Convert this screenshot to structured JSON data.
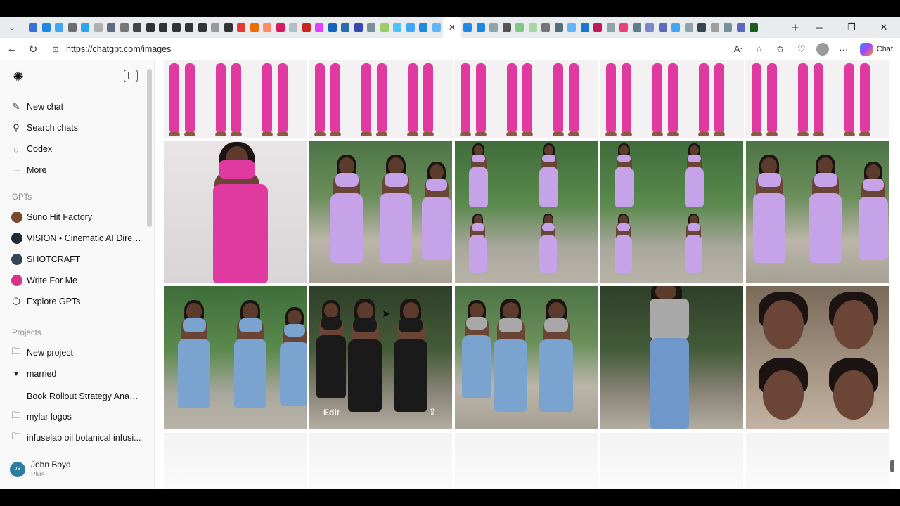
{
  "browser": {
    "url": "https://chatgpt.com/images",
    "copilot_label": "Chat",
    "tab_colors": [
      "#3b6fd8",
      "#1e88e5",
      "#42a5f5",
      "#6d6d6d",
      "#2ea3f2",
      "#b0b0b0",
      "#5d6d7e",
      "#777777",
      "#444444",
      "#333333",
      "#333333",
      "#333333",
      "#333333",
      "#333333",
      "#999999",
      "#333333",
      "#e53935",
      "#ef6c00",
      "#ff8a65",
      "#d81b60",
      "#b0bec5",
      "#c62828",
      "#e040fb",
      "#1565c0",
      "#2b6cb0",
      "#3949ab",
      "#78909c",
      "#9ccc65",
      "#4fc3f7",
      "#42a5f5",
      "#1e88e5",
      "#64b5f6"
    ],
    "tab_colors_right": [
      "#1e88e5",
      "#1e88e5",
      "#90a4ae",
      "#555555",
      "#81c784",
      "#a5d6a7",
      "#757575",
      "#546e7a",
      "#64b5f6",
      "#1976d2",
      "#c2185b",
      "#90a4ae",
      "#ec407a",
      "#607d8b",
      "#7986cb",
      "#5c6bc0",
      "#42a5f5",
      "#90a4ae",
      "#37474f",
      "#9e9e9e",
      "#78909c",
      "#5c6bc0",
      "#1b5e20"
    ],
    "active_tab_close": "✕"
  },
  "sidebar": {
    "nav": [
      {
        "label": "New chat",
        "icon": "edit-icon"
      },
      {
        "label": "Search chats",
        "icon": "search-icon"
      },
      {
        "label": "Codex",
        "icon": "codex-icon"
      },
      {
        "label": "More",
        "icon": "more-icon"
      }
    ],
    "gpts_heading": "GPTs",
    "gpts": [
      {
        "label": "Suno Hit Factory",
        "color": "#7b4a2a"
      },
      {
        "label": "VISION • Cinematic AI Direct...",
        "color": "#1f2a38"
      },
      {
        "label": "SHOTCRAFT",
        "color": "#34445a"
      },
      {
        "label": "Write For Me",
        "color": "#d6338a"
      },
      {
        "label": "Explore GPTs",
        "color": ""
      }
    ],
    "projects_heading": "Projects",
    "projects": [
      {
        "label": "New project",
        "icon": "folder-plus-icon"
      },
      {
        "label": "married",
        "icon": "caret-down-icon"
      },
      {
        "label": "Book Rollout Strategy Analy...",
        "icon": ""
      },
      {
        "label": "mylar logos",
        "icon": "folder-icon"
      },
      {
        "label": "infuselab oil botanical infusi...",
        "icon": "folder-icon"
      }
    ],
    "user": {
      "initials": "JB",
      "name": "John Boyd",
      "plan": "Plus"
    }
  },
  "grid": {
    "hover_edit_label": "Edit",
    "colors": {
      "pink": "#e03aa0",
      "lavender": "#c6a3e8",
      "denim": "#7aa3cf",
      "black": "#1a1a1a",
      "gray_top": "#a8a8a8",
      "skin": "#6a4535"
    }
  }
}
